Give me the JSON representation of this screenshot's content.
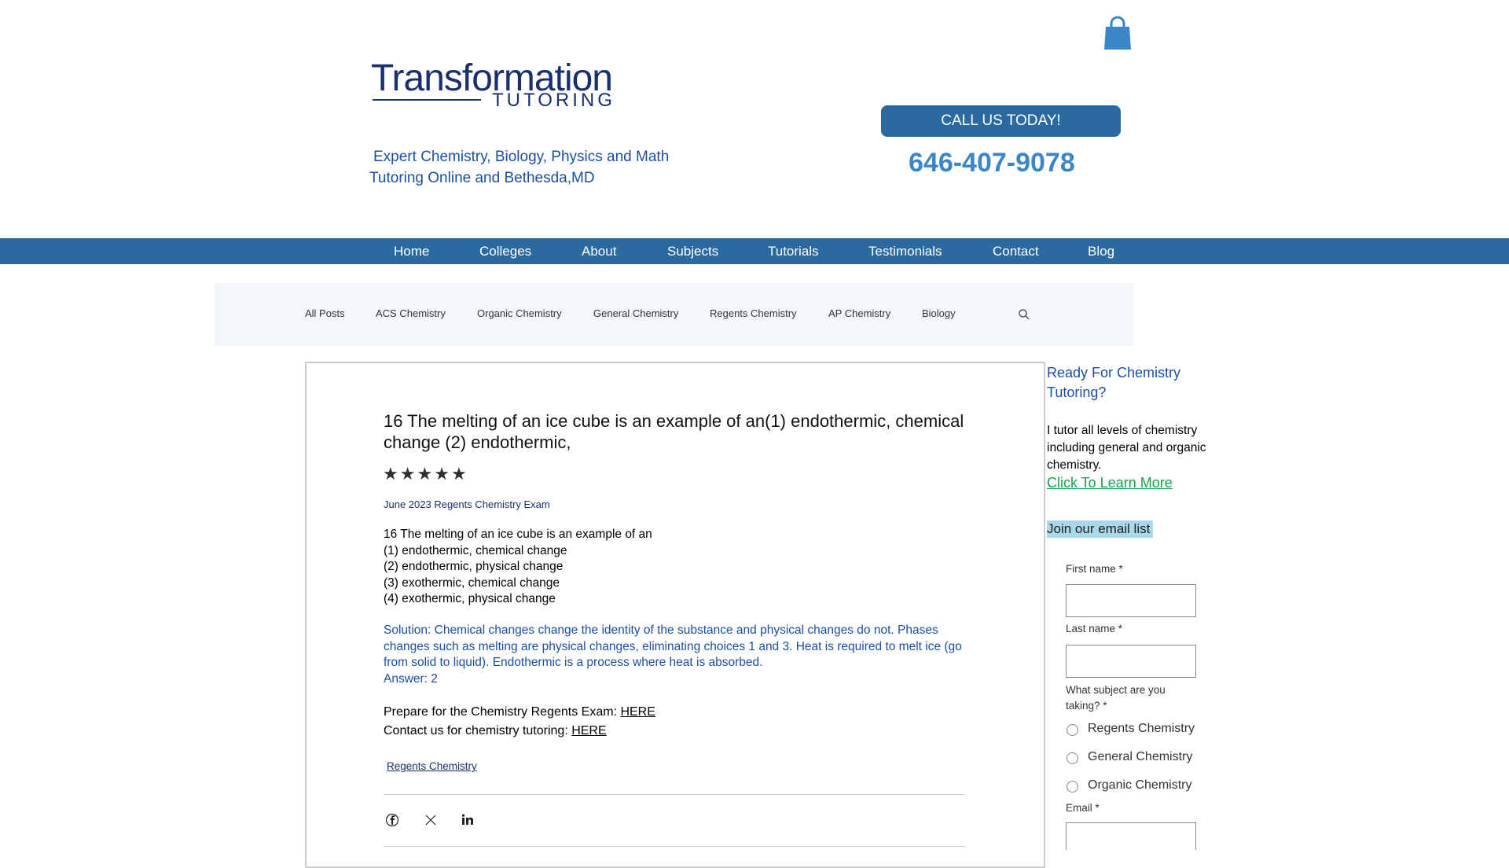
{
  "header": {
    "logo_text": "Transformation",
    "logo_sub": "TUTORING",
    "tagline_line1": "Expert Chemistry, Biology, Physics and Math",
    "tagline_line2": "Tutoring Online and Bethesda,MD",
    "call_button": "CALL US TODAY!",
    "phone": "646-407-9078",
    "cart_icon": "shopping-bag-icon"
  },
  "nav": {
    "items": [
      "Home",
      "Colleges",
      "About",
      "Subjects",
      "Tutorials",
      "Testimonials",
      "Contact",
      "Blog"
    ]
  },
  "categories": {
    "items": [
      "All Posts",
      "ACS Chemistry",
      "Organic Chemistry",
      "General Chemistry",
      "Regents Chemistry",
      "AP Chemistry",
      "Biology"
    ],
    "search_icon": "search-icon"
  },
  "post": {
    "title": "16 The melting of an ice cube is an example of an(1) endothermic, chemical change (2) endothermic,",
    "rating": 5,
    "category": "June 2023 Regents Chemistry Exam",
    "question": [
      "16 The melting of an ice cube is an example of an",
      "(1) endothermic, chemical change",
      "(2) endothermic, physical change",
      "(3) exothermic, chemical change",
      "(4) exothermic, physical change"
    ],
    "solution": "Solution: Chemical changes change the identity of the substance and physical changes do not. Phases changes such as melting are physical changes, eliminating choices 1 and 3. Heat is required to melt ice (go from solid to liquid). Endothermic is a process where heat is absorbed.",
    "answer": "Answer: 2",
    "prepare_text": "Prepare for the Chemistry Regents Exam: ",
    "prepare_link": "HERE",
    "contact_text": "Contact us for chemistry tutoring: ",
    "contact_link": "HERE",
    "tag": "Regents Chemistry",
    "share_icons": [
      "facebook-icon",
      "x-icon",
      "linkedin-icon"
    ]
  },
  "sidebar": {
    "heading": "Ready For Chemistry Tutoring?",
    "text": "I tutor all levels of chemistry including general and organic chemistry.",
    "learn_more": "Click To Learn More",
    "join": "Join our email list",
    "form": {
      "first_name_label": "First name *",
      "last_name_label": "Last name *",
      "subject_label": "What subject are you taking? *",
      "subjects": [
        "Regents Chemistry",
        "General Chemistry",
        "Organic Chemistry"
      ],
      "email_label": "Email *"
    }
  },
  "colors": {
    "nav_bg": "#2a6aa1",
    "brand_blue": "#1c4fa3",
    "phone_blue": "#3a86c8",
    "link_green": "#13a34a",
    "highlight": "#a8d8ea"
  }
}
